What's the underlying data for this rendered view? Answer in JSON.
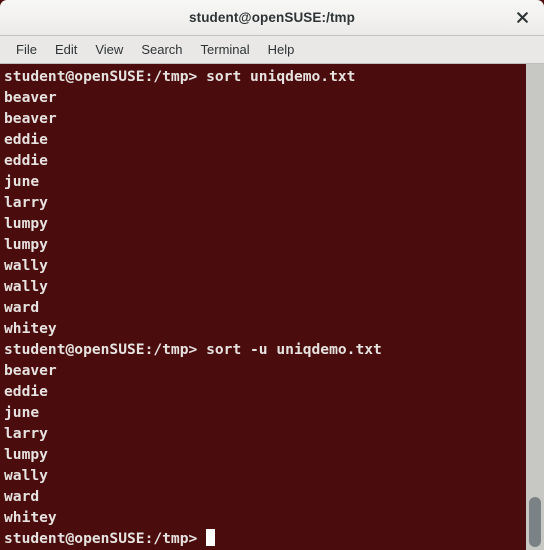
{
  "window": {
    "title": "student@openSUSE:/tmp",
    "close_label": "×",
    "background_color": "#4a0c0c",
    "foreground_color": "#e6e2e0",
    "titlebar_color": "#f2f1f0"
  },
  "menubar": {
    "items": [
      {
        "label": "File"
      },
      {
        "label": "Edit"
      },
      {
        "label": "View"
      },
      {
        "label": "Search"
      },
      {
        "label": "Terminal"
      },
      {
        "label": "Help"
      }
    ]
  },
  "terminal": {
    "prompt": "student@openSUSE:/tmp>",
    "lines": [
      {
        "type": "command",
        "text": "student@openSUSE:/tmp> sort uniqdemo.txt"
      },
      {
        "type": "output",
        "text": "beaver"
      },
      {
        "type": "output",
        "text": "beaver"
      },
      {
        "type": "output",
        "text": "eddie"
      },
      {
        "type": "output",
        "text": "eddie"
      },
      {
        "type": "output",
        "text": "june"
      },
      {
        "type": "output",
        "text": "larry"
      },
      {
        "type": "output",
        "text": "lumpy"
      },
      {
        "type": "output",
        "text": "lumpy"
      },
      {
        "type": "output",
        "text": "wally"
      },
      {
        "type": "output",
        "text": "wally"
      },
      {
        "type": "output",
        "text": "ward"
      },
      {
        "type": "output",
        "text": "whitey"
      },
      {
        "type": "command",
        "text": "student@openSUSE:/tmp> sort -u uniqdemo.txt"
      },
      {
        "type": "output",
        "text": "beaver"
      },
      {
        "type": "output",
        "text": "eddie"
      },
      {
        "type": "output",
        "text": "june"
      },
      {
        "type": "output",
        "text": "larry"
      },
      {
        "type": "output",
        "text": "lumpy"
      },
      {
        "type": "output",
        "text": "wally"
      },
      {
        "type": "output",
        "text": "ward"
      },
      {
        "type": "output",
        "text": "whitey"
      },
      {
        "type": "prompt",
        "text": "student@openSUSE:/tmp> "
      }
    ],
    "commands_run": [
      "sort uniqdemo.txt",
      "sort -u uniqdemo.txt"
    ]
  },
  "scrollbar": {
    "orientation": "vertical",
    "thumb_position": "bottom"
  }
}
